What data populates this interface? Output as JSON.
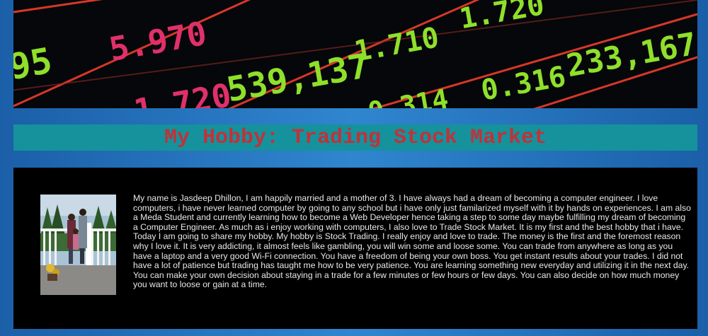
{
  "banner": {
    "alt": "Stock market ticker board",
    "ticker_values": [
      {
        "text": "95",
        "color": "#8fe02a"
      },
      {
        "text": "5.970",
        "color": "#e0306a"
      },
      {
        "text": "1.710",
        "color": "#8fe02a"
      },
      {
        "text": "1.720",
        "color": "#8fe02a"
      },
      {
        "text": "539,137",
        "color": "#8fe02a"
      },
      {
        "text": "0.316",
        "color": "#8fe02a"
      },
      {
        "text": "233,167",
        "color": "#8fe02a"
      },
      {
        "text": "1.720",
        "color": "#e0306a"
      },
      {
        "text": "0.314",
        "color": "#8fe02a"
      }
    ]
  },
  "title": "My Hobby: Trading Stock Market",
  "bio": "My name is Jasdeep Dhillon, I am happily married and a mother of 3. I have always had a dream of becoming a computer engineer. I love computers, i have never learned computer by going to any school but i have only just familarized myself with it by hands on experiences. I am also a Meda Student and currently learning how to become a Web Developer hence taking a step to some day maybe fulfilling my dream of becoming a Computer Engineer. As much as i enjoy working with computers, I also love to Trade Stock Market. It is my first and the best hobby that i have. Today I am going to share my hobby. My hobby is Stock Trading. I really enjoy and love to trade. The money is the first and the foremost reason why I love it. It is very addicting, it almost feels like gambling, you will win some and loose some. You can trade from anywhere as long as you have a laptop and a very good Wi-Fi connection. You have a freedom of being your own boss. You get instant results about your trades. I did not have a lot of patience but trading has taught me how to be very patience. You are learning something new everyday and utilizing it in the next day. You can make your own decision about staying in a trade for a few minutes or few hours or few days. You can also decide on how much money you want to loose or gain at a time.",
  "photo": {
    "alt": "Family photo on a deck"
  }
}
